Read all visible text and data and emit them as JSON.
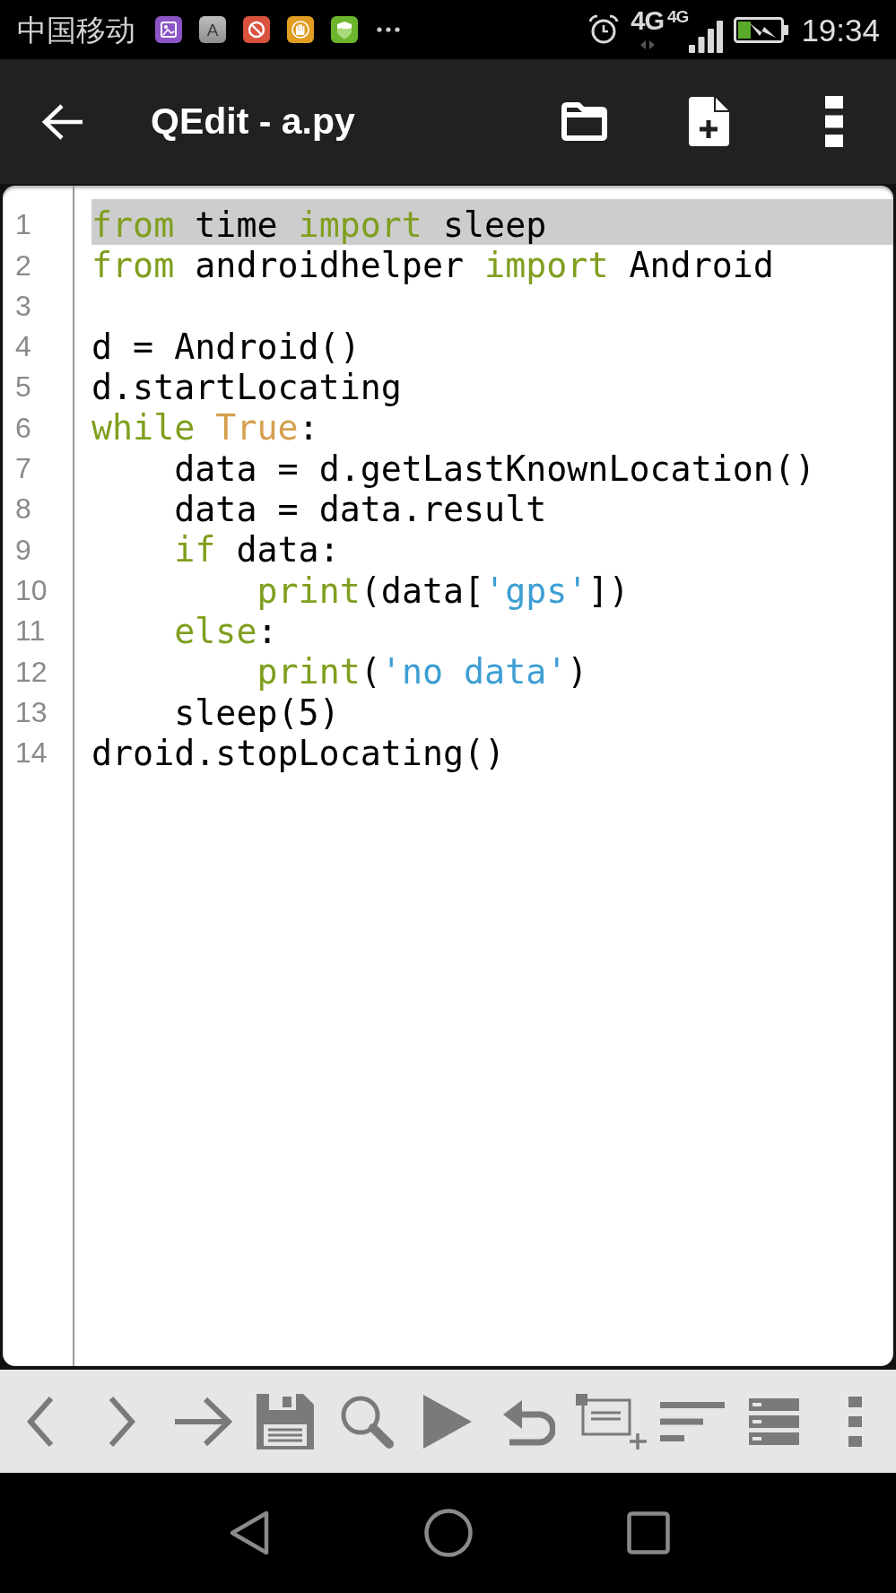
{
  "status_bar": {
    "carrier": "中国移动",
    "app_icon_letter": "A",
    "network_type": "4G",
    "signal_type": "4G",
    "time": "19:34"
  },
  "app_bar": {
    "title": "QEdit - a.py"
  },
  "editor": {
    "lines": [
      {
        "number": "1",
        "highlighted": true,
        "tokens": [
          {
            "text": "from",
            "kind": "keyword"
          },
          {
            "text": " time ",
            "kind": "plain"
          },
          {
            "text": "import",
            "kind": "keyword"
          },
          {
            "text": " sleep",
            "kind": "plain"
          }
        ]
      },
      {
        "number": "2",
        "highlighted": false,
        "tokens": [
          {
            "text": "from",
            "kind": "keyword"
          },
          {
            "text": " androidhelper ",
            "kind": "plain"
          },
          {
            "text": "import",
            "kind": "keyword"
          },
          {
            "text": " Android",
            "kind": "plain"
          }
        ]
      },
      {
        "number": "3",
        "highlighted": false
      },
      {
        "number": "4",
        "highlighted": false,
        "tokens": [
          {
            "text": "d = Android()",
            "kind": "plain"
          }
        ]
      },
      {
        "number": "5",
        "highlighted": false,
        "tokens": [
          {
            "text": "d.startLocating",
            "kind": "plain"
          }
        ]
      },
      {
        "number": "6",
        "highlighted": false,
        "tokens": [
          {
            "text": "while",
            "kind": "keyword"
          },
          {
            "text": " True",
            "kind": "constant"
          },
          {
            "text": ":",
            "kind": "plain"
          }
        ]
      },
      {
        "number": "7",
        "highlighted": false,
        "tokens": [
          {
            "text": "    data = d.getLastKnownLocation()",
            "kind": "plain"
          }
        ]
      },
      {
        "number": "8",
        "highlighted": false,
        "tokens": [
          {
            "text": "    data = data.result",
            "kind": "plain"
          }
        ]
      },
      {
        "number": "9",
        "highlighted": false,
        "tokens": [
          {
            "text": "    if",
            "kind": "keyword"
          },
          {
            "text": " data:",
            "kind": "plain"
          }
        ]
      },
      {
        "number": "10",
        "highlighted": false,
        "tokens": [
          {
            "text": "        print",
            "kind": "keyword"
          },
          {
            "text": "(data[",
            "kind": "plain"
          },
          {
            "text": "'gps'",
            "kind": "string"
          },
          {
            "text": "])",
            "kind": "plain"
          }
        ]
      },
      {
        "number": "11",
        "highlighted": false,
        "tokens": [
          {
            "text": "    else",
            "kind": "keyword"
          },
          {
            "text": ":",
            "kind": "plain"
          }
        ]
      },
      {
        "number": "12",
        "highlighted": false,
        "tokens": [
          {
            "text": "        print",
            "kind": "keyword"
          },
          {
            "text": "(",
            "kind": "plain"
          },
          {
            "text": "'no data'",
            "kind": "string"
          },
          {
            "text": ")",
            "kind": "plain"
          }
        ]
      },
      {
        "number": "13",
        "highlighted": false,
        "tokens": [
          {
            "text": "    sleep(5)",
            "kind": "plain"
          }
        ]
      },
      {
        "number": "14",
        "highlighted": false,
        "tokens": [
          {
            "text": "droid.stopLocating()",
            "kind": "plain"
          }
        ]
      }
    ]
  }
}
